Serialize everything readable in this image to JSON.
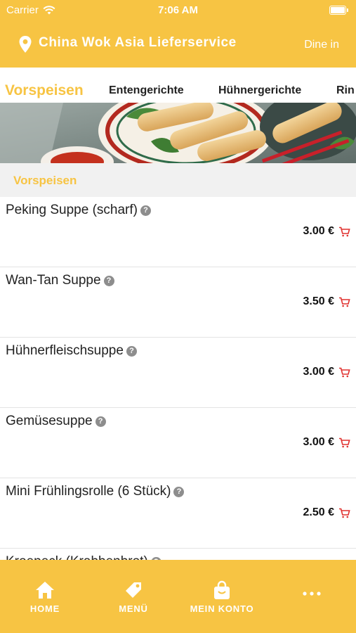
{
  "status_bar": {
    "carrier": "Carrier",
    "time": "7:06 AM"
  },
  "header": {
    "title": "China Wok Asia Lieferservice",
    "dine_in": "Dine in"
  },
  "tabs": [
    {
      "label": "Vorspeisen"
    },
    {
      "label": "Entengerichte"
    },
    {
      "label": "Hühnergerichte"
    },
    {
      "label": "Rin"
    }
  ],
  "section": {
    "title": "Vorspeisen"
  },
  "items": [
    {
      "name": "Peking Suppe (scharf)",
      "price": "3.00 €"
    },
    {
      "name": "Wan-Tan Suppe",
      "price": "3.50 €"
    },
    {
      "name": "Hühnerfleischsuppe",
      "price": "3.00 €"
    },
    {
      "name": "Gemüsesuppe",
      "price": "3.00 €"
    },
    {
      "name": "Mini Frühlingsrolle (6 Stück)",
      "price": "2.50 €"
    },
    {
      "name": "Kroepeck (Krabbenbrot)",
      "price": ""
    }
  ],
  "bottom_nav": [
    {
      "label": "HOME",
      "icon": "home-icon"
    },
    {
      "label": "MENÜ",
      "icon": "tag-icon"
    },
    {
      "label": "MEIN KONTO",
      "icon": "shopping-bag-icon"
    },
    {
      "label": "",
      "icon": "more-icon"
    }
  ],
  "colors": {
    "accent": "#f7c443",
    "cart": "#e0312f",
    "text": "#222222"
  }
}
